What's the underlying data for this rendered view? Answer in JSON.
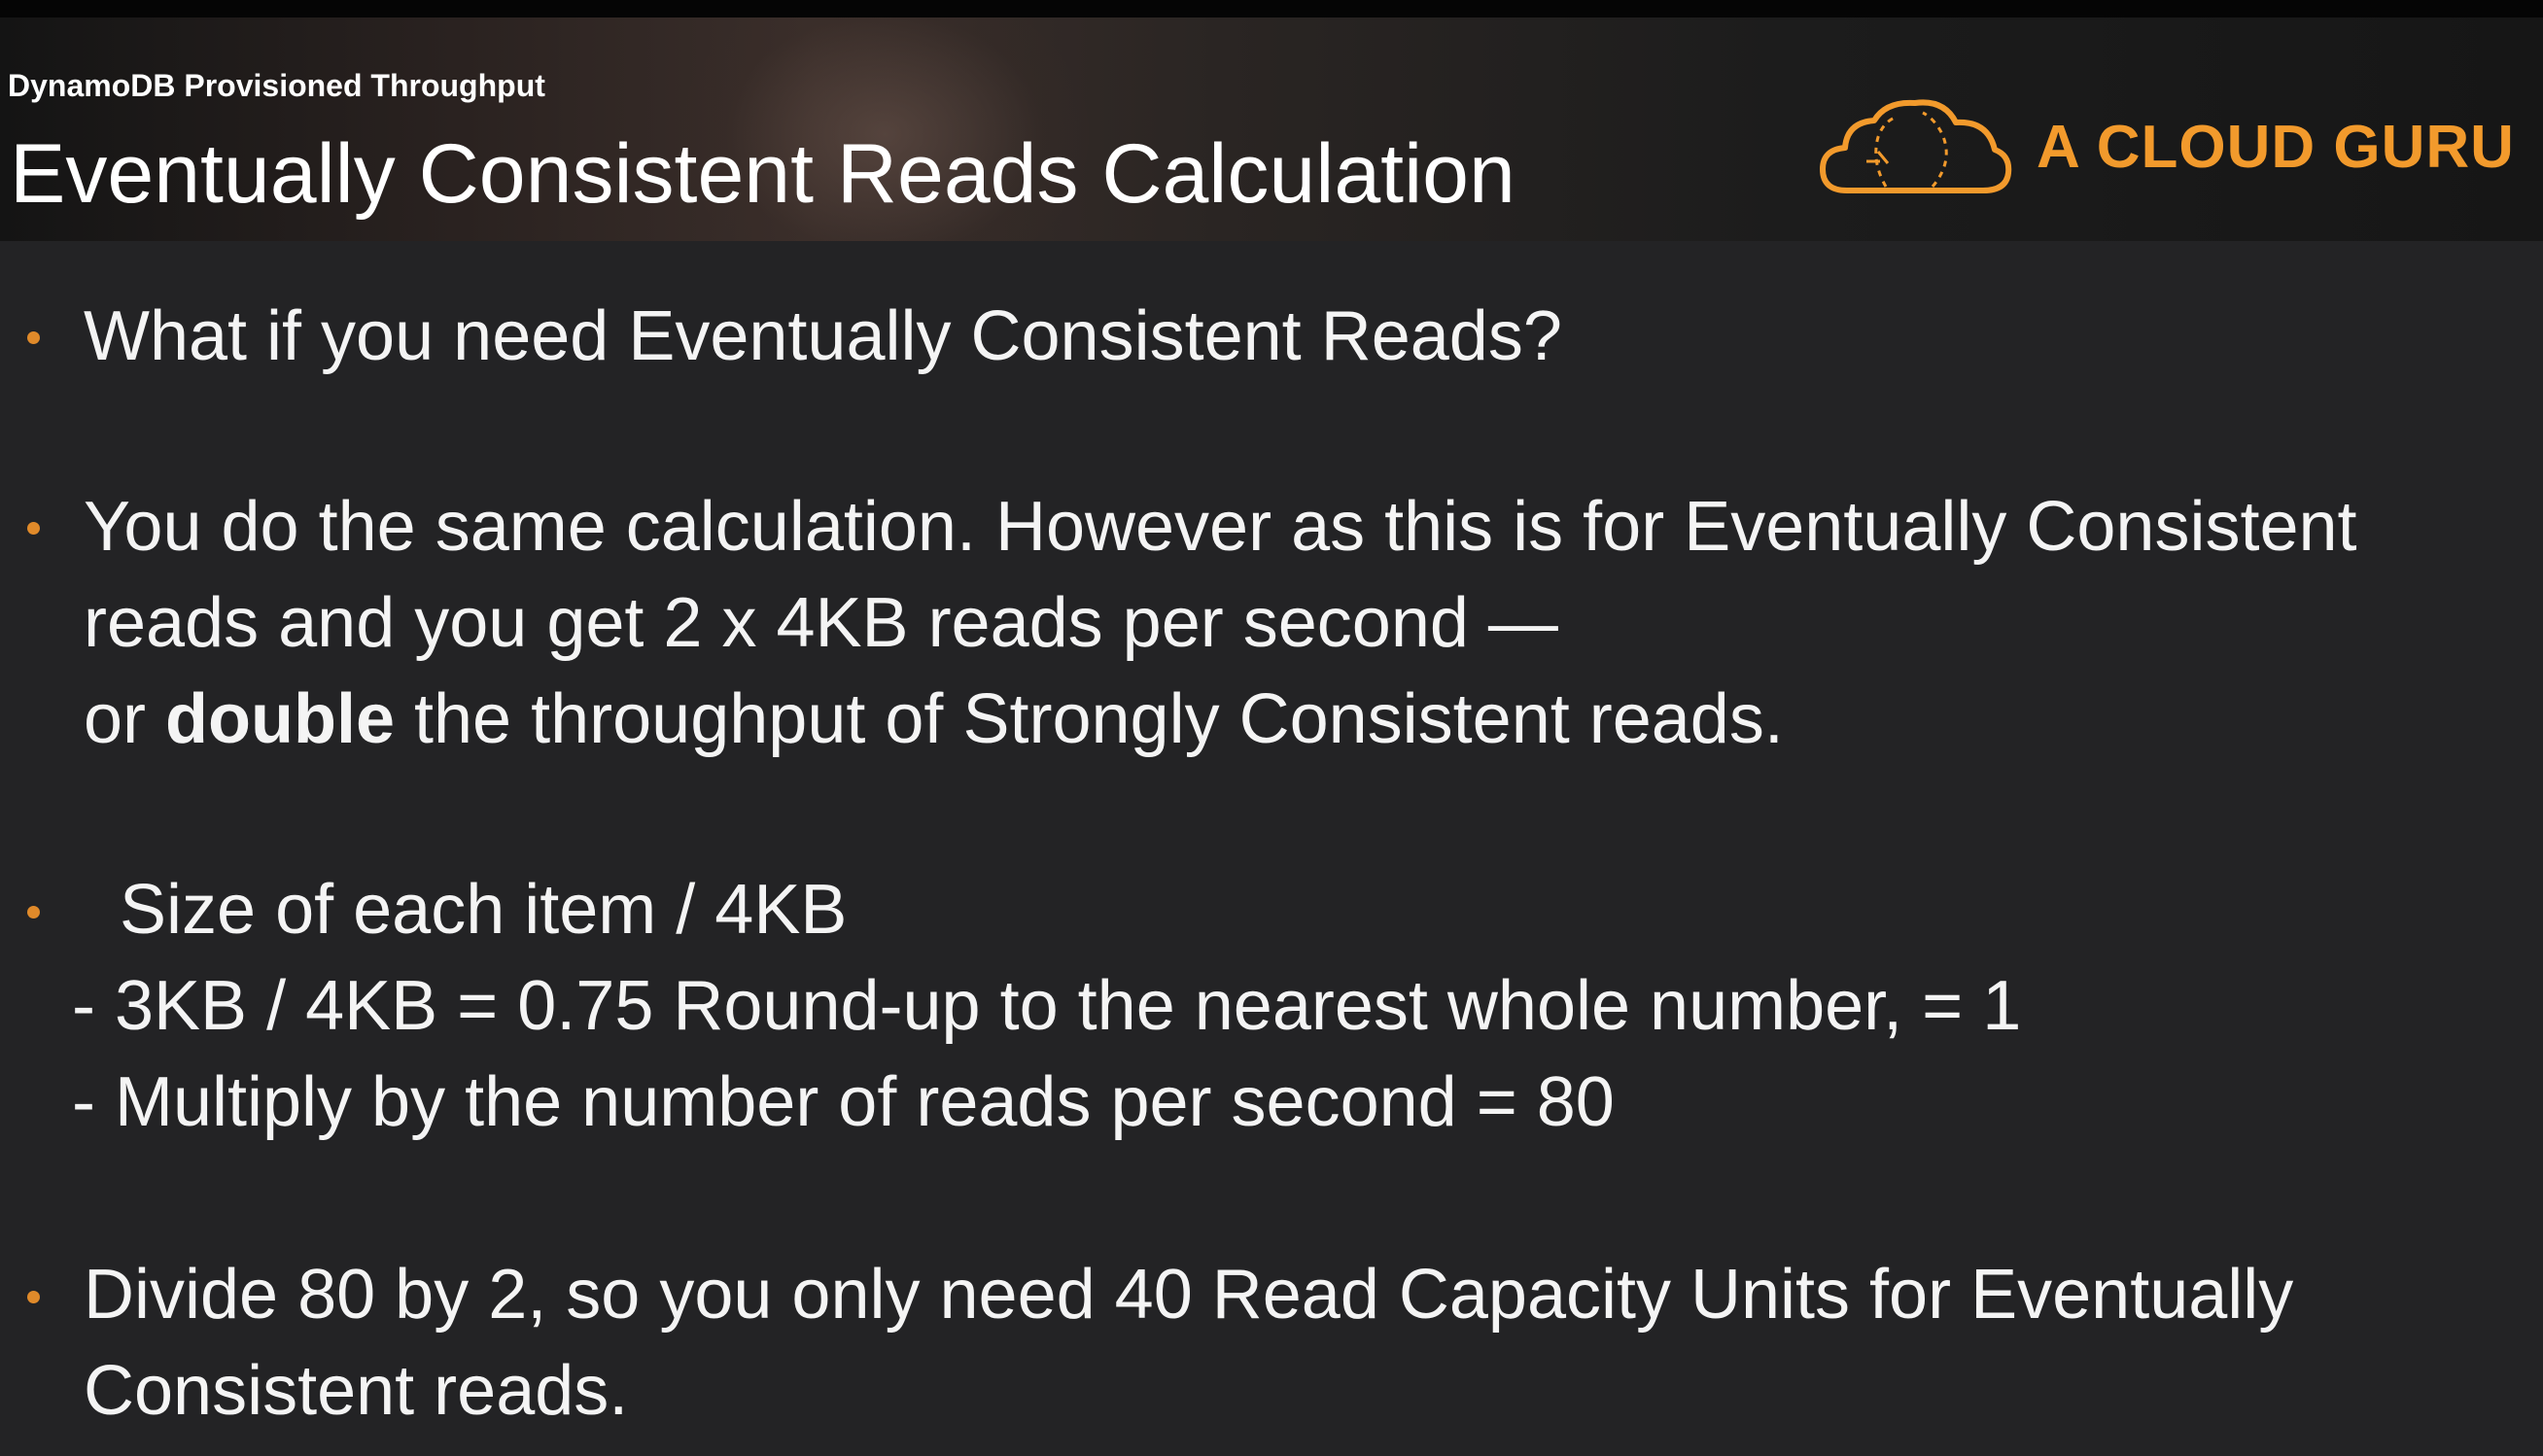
{
  "header": {
    "subtitle": "DynamoDB Provisioned Throughput",
    "title": "Eventually Consistent Reads Calculation",
    "logo_text": "A CLOUD GURU",
    "logo_color": "#f29a2c"
  },
  "bullets": {
    "b1": {
      "line1": "What if you need Eventually Consistent Reads?"
    },
    "b2": {
      "line1": "You do the same calculation. However as this is for Eventually Consistent",
      "line2": "reads and you get 2 x 4KB reads per second —",
      "line3_pre": "or ",
      "line3_bold": "double",
      "line3_post": " the throughput of Strongly Consistent reads."
    },
    "b3": {
      "line1": "Size of each item / 4KB",
      "line2": "- 3KB / 4KB = 0.75  Round-up to the nearest whole number,  =  1",
      "line3": "- Multiply by the number of reads per second = 80"
    },
    "b4": {
      "line1": "Divide 80 by 2, so you only need 40 Read Capacity Units for Eventually",
      "line2": "Consistent reads."
    }
  },
  "colors": {
    "background": "#232325",
    "bullet": "#e08a2a",
    "text": "#f4f4f4"
  }
}
